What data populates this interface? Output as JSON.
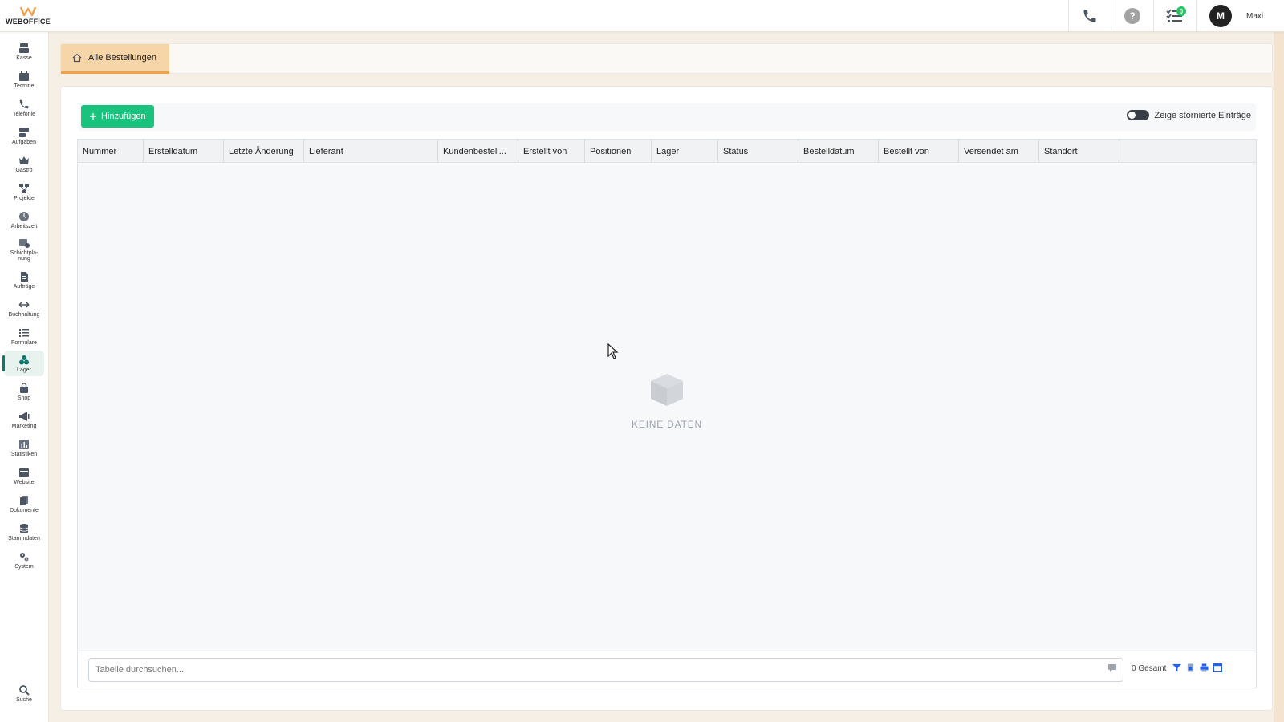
{
  "app": {
    "logo_text": "WEBOFFICE",
    "colors": {
      "accent_green": "#19c37d",
      "tab_active_bg": "#f6d6a8",
      "tab_active_border": "#f0a04b",
      "sidebar_active": "#0f766e",
      "background": "#f6efe6"
    }
  },
  "topbar": {
    "phone_icon": "phone-icon",
    "help_icon": "help-icon",
    "help_symbol": "?",
    "tasks_icon": "tasks-icon",
    "tasks_badge": "0",
    "avatar_initial": "M",
    "username": "Maxi"
  },
  "sidebar": {
    "items": [
      {
        "label": "Kasse",
        "icon": "register-icon"
      },
      {
        "label": "Termine",
        "icon": "calendar-icon"
      },
      {
        "label": "Telefonie",
        "icon": "phone-icon"
      },
      {
        "label": "Aufgaben",
        "icon": "tasks-icon"
      },
      {
        "label": "Gastro",
        "icon": "crown-icon"
      },
      {
        "label": "Projekte",
        "icon": "projects-icon"
      },
      {
        "label": "Arbeitszeit",
        "icon": "clock-icon"
      },
      {
        "label": "Schichtpla-\nnung",
        "icon": "shift-calendar-icon"
      },
      {
        "label": "Aufträge",
        "icon": "document-icon"
      },
      {
        "label": "Buchhaltung",
        "icon": "arrows-icon"
      },
      {
        "label": "Formulare",
        "icon": "checklist-icon"
      },
      {
        "label": "Lager",
        "icon": "boxes-icon",
        "active": true
      },
      {
        "label": "Shop",
        "icon": "shopping-bag-icon"
      },
      {
        "label": "Marketing",
        "icon": "megaphone-icon"
      },
      {
        "label": "Statistiken",
        "icon": "chart-icon"
      },
      {
        "label": "Website",
        "icon": "browser-icon"
      },
      {
        "label": "Dokumente",
        "icon": "files-icon"
      },
      {
        "label": "Stammdaten",
        "icon": "database-icon"
      },
      {
        "label": "System",
        "icon": "gears-icon"
      }
    ],
    "search_label": "Suche",
    "search_icon": "search-icon"
  },
  "tabs": [
    {
      "label": "Alle Bestellungen",
      "icon": "home-icon",
      "active": true
    }
  ],
  "toolbar": {
    "add_label": "Hinzufügen",
    "toggle_label": "Zeige stornierte Einträge",
    "toggle_on": false
  },
  "table": {
    "columns": [
      "Nummer",
      "Erstelldatum",
      "Letzte Änderung",
      "Lieferant",
      "Kundenbestell...",
      "Erstellt von",
      "Positionen",
      "Lager",
      "Status",
      "Bestelldatum",
      "Bestellt von",
      "Versendet am",
      "Standort"
    ],
    "rows": [],
    "empty_text": "KEINE DATEN",
    "empty_icon": "box-icon"
  },
  "footer": {
    "search_placeholder": "Tabelle durchsuchen...",
    "total_text": "0 Gesamt",
    "icons": [
      "filter-icon",
      "export-icon",
      "print-icon",
      "columns-icon"
    ]
  }
}
